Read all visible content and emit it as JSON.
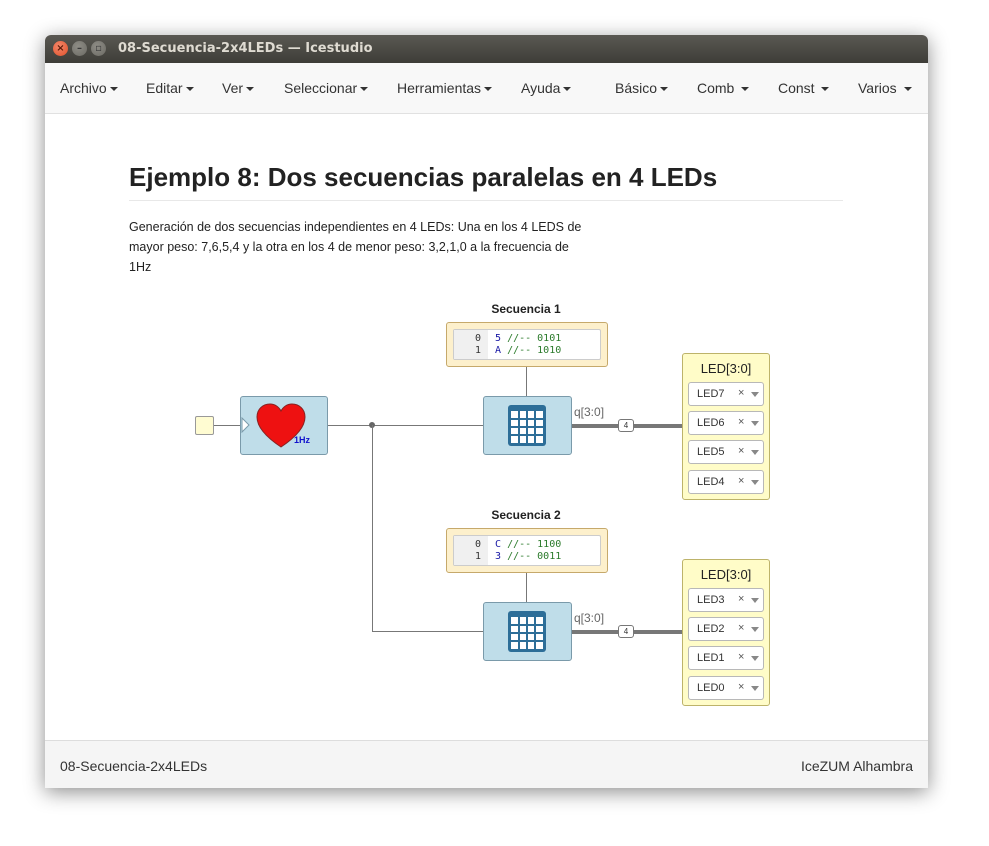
{
  "window": {
    "title": "08-Secuencia-2x4LEDs — Icestudio",
    "close_glyph": "×",
    "min_glyph": "–",
    "max_glyph": "▫"
  },
  "menu": [
    {
      "label": "Archivo"
    },
    {
      "label": "Editar"
    },
    {
      "label": "Ver"
    },
    {
      "label": "Seleccionar"
    },
    {
      "label": "Herramientas"
    },
    {
      "label": "Ayuda"
    },
    {
      "label": "Básico"
    },
    {
      "label": "Comb"
    },
    {
      "label": "Const"
    },
    {
      "label": "Varios"
    }
  ],
  "document": {
    "title": "Ejemplo 8: Dos secuencias paralelas en 4 LEDs",
    "description": "Generación de dos secuencias independientes en 4 LEDs: Una en los 4 LEDS de mayor peso: 7,6,5,4 y la otra en los 4 de menor peso: 3,2,1,0 a la frecuencia de 1Hz"
  },
  "diagram": {
    "clock_label": "1Hz",
    "heart_color": "#ee1111",
    "block_color": "#bfdde9",
    "memory_color": "#fdf0cc",
    "output_color": "#fffcc8",
    "seq1": {
      "title": "Secuencia 1",
      "rows": [
        {
          "n": "0",
          "v": "5",
          "c": "//-- 0101"
        },
        {
          "n": "1",
          "v": "A",
          "c": "//-- 1010"
        }
      ],
      "port": "q[3:0]",
      "bus_width": "4",
      "out_title": "LED[3:0]",
      "leds": [
        "LED7",
        "LED6",
        "LED5",
        "LED4"
      ]
    },
    "seq2": {
      "title": "Secuencia 2",
      "rows": [
        {
          "n": "0",
          "v": "C",
          "c": "//-- 1100"
        },
        {
          "n": "1",
          "v": "3",
          "c": "//-- 0011"
        }
      ],
      "port": "q[3:0]",
      "bus_width": "4",
      "out_title": "LED[3:0]",
      "leds": [
        "LED3",
        "LED2",
        "LED1",
        "LED0"
      ]
    },
    "remove_glyph": "×"
  },
  "footer": {
    "left": "08-Secuencia-2x4LEDs",
    "right": "IceZUM Alhambra"
  }
}
